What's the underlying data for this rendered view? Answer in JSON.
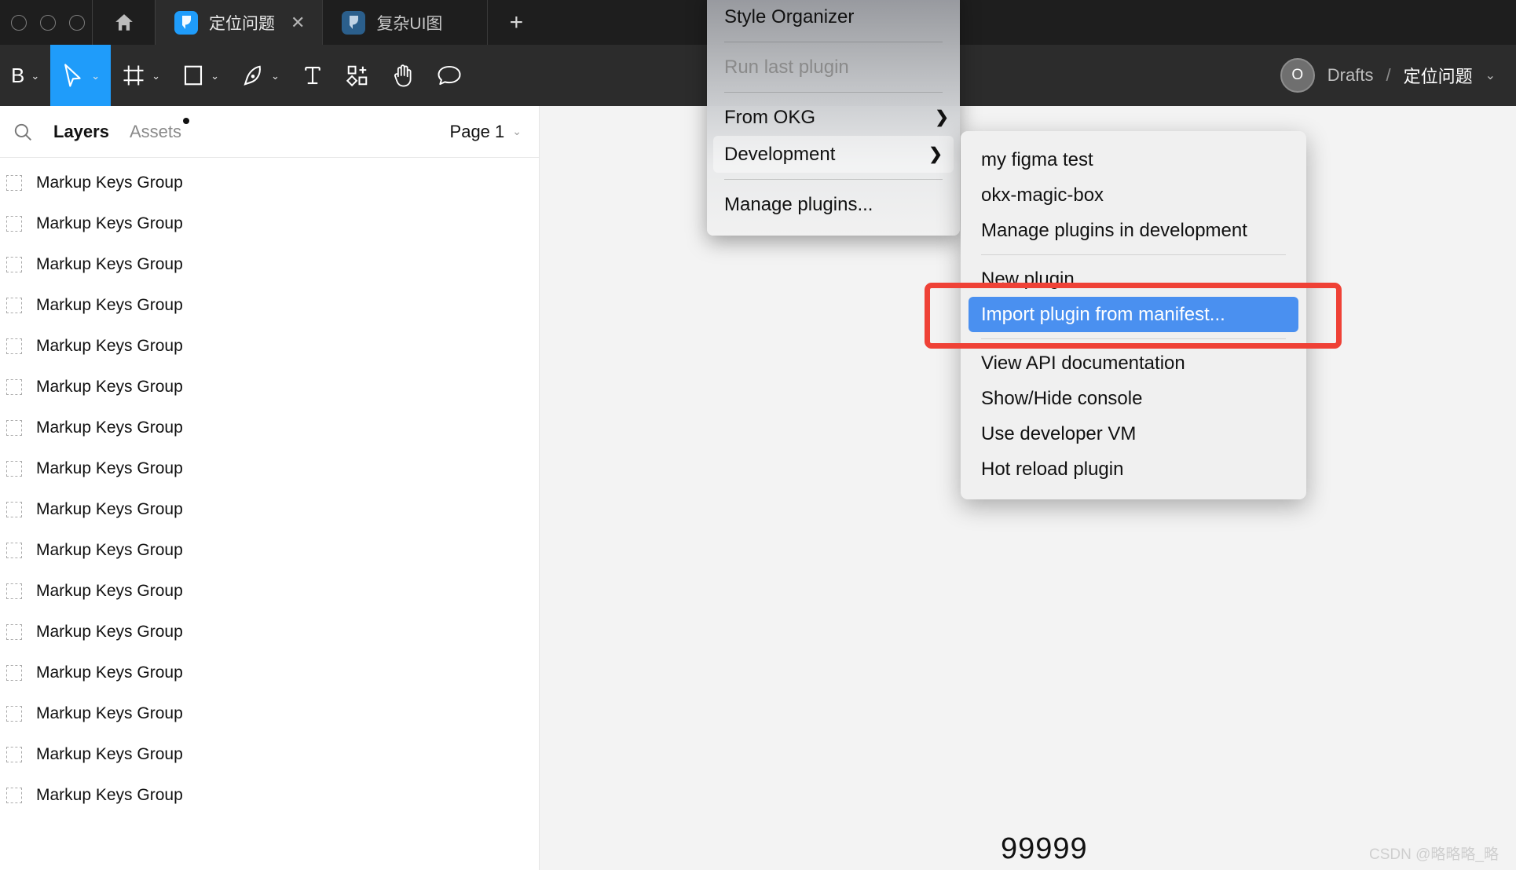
{
  "window": {
    "traffic_lights": [
      "close",
      "minimize",
      "maximize"
    ],
    "home_icon": "home-icon",
    "new_tab_label": "+",
    "tabs": [
      {
        "title": "定位问题",
        "icon": "figma-file-icon",
        "close_label": "✕",
        "active": true
      },
      {
        "title": "复杂UI图",
        "icon": "figma-file-icon",
        "active": false
      }
    ]
  },
  "toolbar": {
    "tools": [
      {
        "name": "move-tool",
        "glyph": "B",
        "has_caret": true
      },
      {
        "name": "cursor-tool",
        "glyph": "cursor-icon",
        "has_caret": true,
        "selected": true
      },
      {
        "name": "frame-tool",
        "glyph": "frame-icon",
        "has_caret": true
      },
      {
        "name": "shape-tool",
        "glyph": "rectangle-icon",
        "has_caret": true
      },
      {
        "name": "pen-tool",
        "glyph": "pen-icon",
        "has_caret": true
      },
      {
        "name": "text-tool",
        "glyph": "text-icon",
        "has_caret": false
      },
      {
        "name": "components-tool",
        "glyph": "components-icon",
        "has_caret": false
      },
      {
        "name": "hand-tool",
        "glyph": "hand-icon",
        "has_caret": false
      },
      {
        "name": "comment-tool",
        "glyph": "comment-icon",
        "has_caret": false
      }
    ],
    "avatar_initial": "O",
    "breadcrumb_root": "Drafts",
    "breadcrumb_sep": "/",
    "breadcrumb_current": "定位问题",
    "breadcrumb_caret": "⌄",
    "accent_color": "#1f9cfa"
  },
  "left_panel": {
    "search_icon": "search-icon",
    "tabs": [
      {
        "label": "Layers",
        "active": true,
        "badge": false
      },
      {
        "label": "Assets",
        "active": false,
        "badge": true
      }
    ],
    "page_selector": {
      "label": "Page 1",
      "caret": "⌄"
    },
    "layers": [
      {
        "label": "Markup Keys Group"
      },
      {
        "label": "Markup Keys Group"
      },
      {
        "label": "Markup Keys Group"
      },
      {
        "label": "Markup Keys Group"
      },
      {
        "label": "Markup Keys Group"
      },
      {
        "label": "Markup Keys Group"
      },
      {
        "label": "Markup Keys Group"
      },
      {
        "label": "Markup Keys Group"
      },
      {
        "label": "Markup Keys Group"
      },
      {
        "label": "Markup Keys Group"
      },
      {
        "label": "Markup Keys Group"
      },
      {
        "label": "Markup Keys Group"
      },
      {
        "label": "Markup Keys Group"
      },
      {
        "label": "Markup Keys Group"
      },
      {
        "label": "Markup Keys Group"
      },
      {
        "label": "Markup Keys Group"
      }
    ]
  },
  "canvas": {
    "number_text": "99999",
    "watermark": "CSDN @略略略_略"
  },
  "plugin_menu": {
    "items": [
      {
        "label": "Style Organizer",
        "type": "item"
      },
      {
        "type": "separator"
      },
      {
        "label": "Run last plugin",
        "type": "item",
        "disabled": true
      },
      {
        "type": "separator"
      },
      {
        "label": "From OKG",
        "type": "submenu",
        "arrow": "❯"
      },
      {
        "label": "Development",
        "type": "submenu",
        "arrow": "❯",
        "highlighted": true
      },
      {
        "type": "separator"
      },
      {
        "label": "Manage plugins...",
        "type": "item"
      }
    ]
  },
  "development_submenu": {
    "items": [
      {
        "label": "my figma test",
        "type": "item"
      },
      {
        "label": "okx-magic-box",
        "type": "item"
      },
      {
        "label": "Manage plugins in development",
        "type": "item"
      },
      {
        "type": "separator"
      },
      {
        "label": "New plugin",
        "type": "item"
      },
      {
        "label": "Import plugin from manifest...",
        "type": "item",
        "selected": true
      },
      {
        "type": "separator"
      },
      {
        "label": "View API documentation",
        "type": "item"
      },
      {
        "label": "Show/Hide console",
        "type": "item"
      },
      {
        "label": "Use developer VM",
        "type": "item"
      },
      {
        "label": "Hot reload plugin",
        "type": "item"
      }
    ],
    "selected_color": "#4a90f0"
  },
  "annotation": {
    "highlight_color": "#ef4136",
    "target": "Import plugin from manifest..."
  }
}
